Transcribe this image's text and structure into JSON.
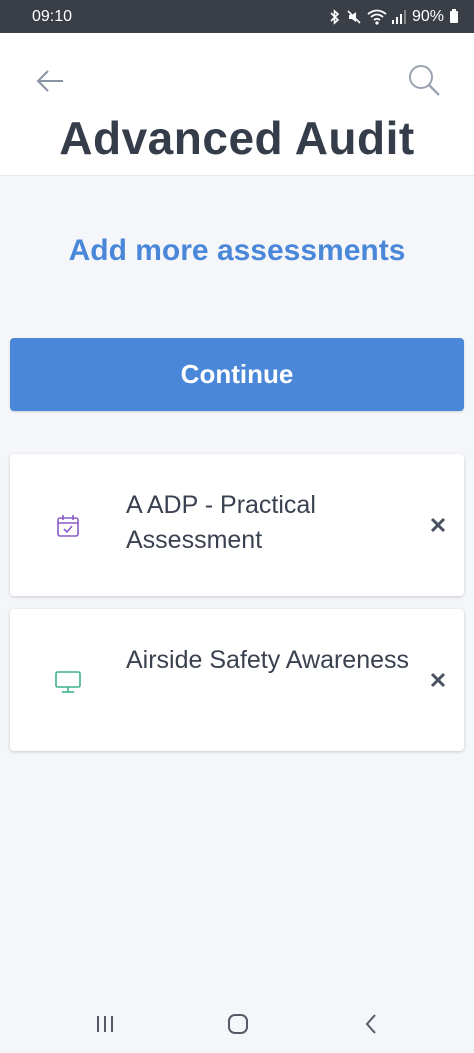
{
  "status_bar": {
    "time": "09:10",
    "battery": "90%"
  },
  "header": {
    "title": "Advanced Audit",
    "back_icon": "arrow-left-icon",
    "search_icon": "search-icon"
  },
  "add_more_label": "Add more assessments",
  "continue_label": "Continue",
  "assessments": [
    {
      "title": "A ADP - Practical Assessment",
      "icon": "calendar-check-icon",
      "icon_color": "#8a5cc7"
    },
    {
      "title": "Airside Safety Awareness",
      "icon": "monitor-icon",
      "icon_color": "#3db38a"
    }
  ],
  "colors": {
    "accent": "#4a87d9",
    "title": "#353c4a",
    "status_bar": "#3a3f47"
  },
  "nav_bar": {
    "recent_icon": "recent-apps-icon",
    "home_icon": "home-icon",
    "back_icon": "back-chevron-icon"
  }
}
